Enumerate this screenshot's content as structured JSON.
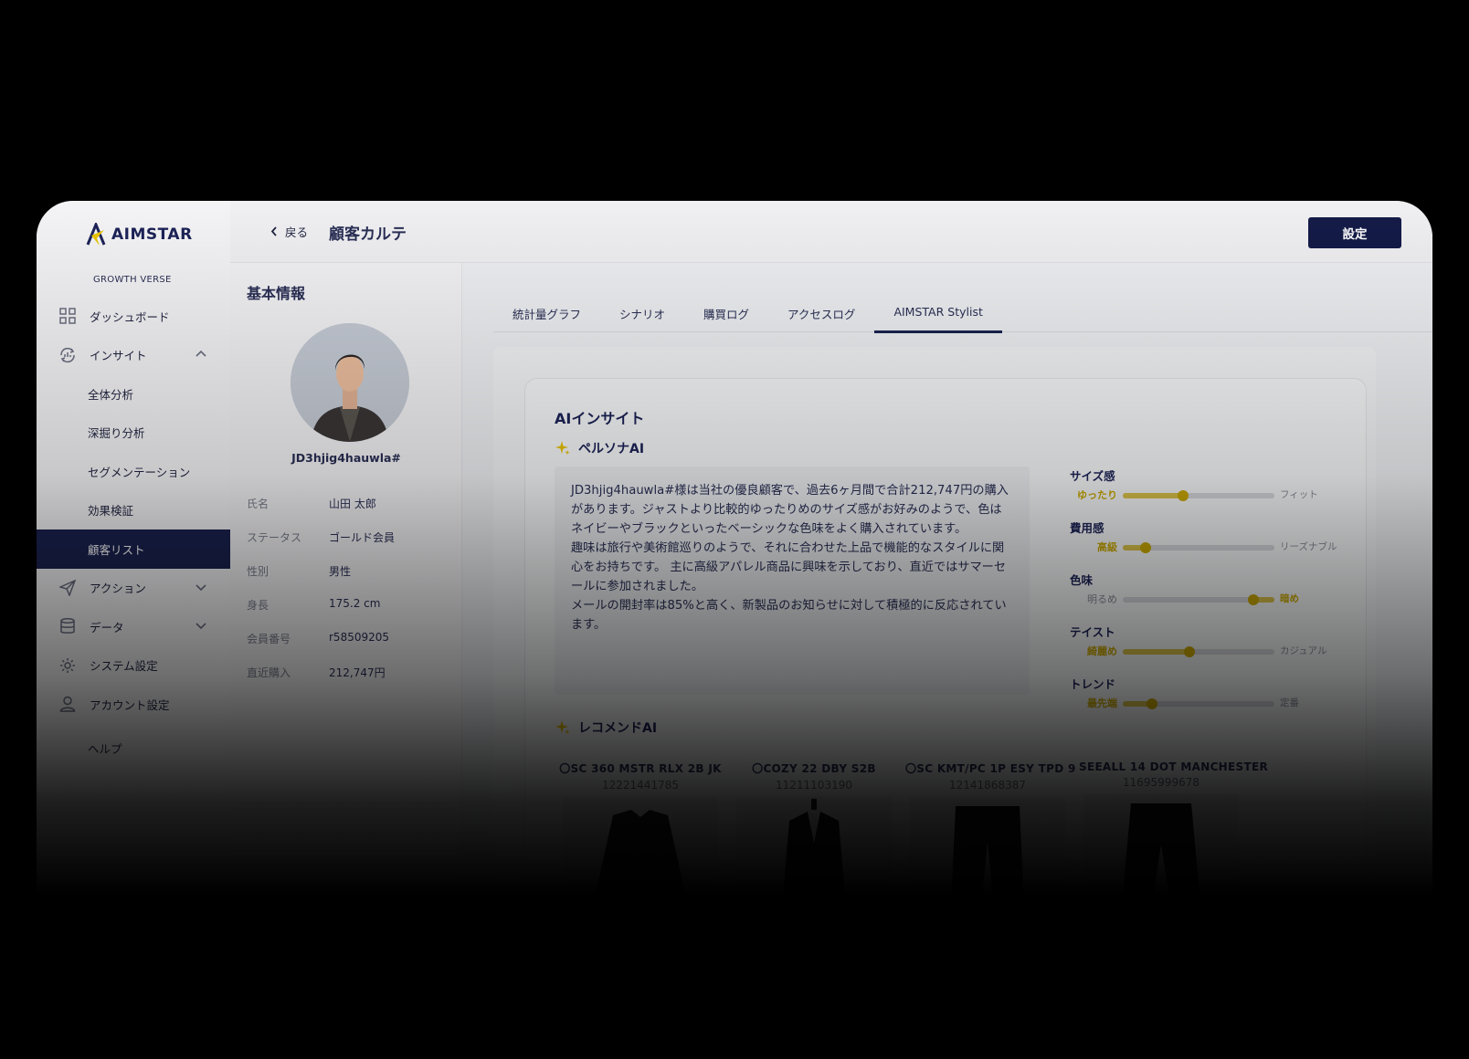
{
  "sidebar": {
    "logo_text": "AIMSTAR",
    "tagline": "GROWTH VERSE",
    "items": [
      {
        "label": "ダッシュボード"
      },
      {
        "label": "インサイト"
      },
      {
        "label": "全体分析"
      },
      {
        "label": "深掘り分析"
      },
      {
        "label": "セグメンテーション"
      },
      {
        "label": "効果検証"
      },
      {
        "label": "顧客リスト"
      },
      {
        "label": "アクション"
      },
      {
        "label": "データ"
      },
      {
        "label": "システム設定"
      },
      {
        "label": "アカウント設定"
      },
      {
        "label": "ヘルプ"
      }
    ]
  },
  "header": {
    "back_label": "戻る",
    "title": "顧客カルテ",
    "settings_label": "設定"
  },
  "info": {
    "title": "基本情報",
    "user_id": "JD3hjig4hauwla#",
    "fields": [
      {
        "key": "氏名",
        "value": "山田 太郎"
      },
      {
        "key": "ステータス",
        "value": "ゴールド会員"
      },
      {
        "key": "性別",
        "value": "男性"
      },
      {
        "key": "身長",
        "value": "175.2 cm"
      },
      {
        "key": "会員番号",
        "value": "r58509205"
      },
      {
        "key": "直近購入",
        "value": "212,747円"
      }
    ]
  },
  "tabs": [
    {
      "label": "統計量グラフ"
    },
    {
      "label": "シナリオ"
    },
    {
      "label": "購買ログ"
    },
    {
      "label": "アクセスログ"
    },
    {
      "label": "AIMSTAR Stylist"
    }
  ],
  "insight": {
    "title": "AIインサイト",
    "persona_title": "ペルソナAI",
    "persona_text": "JD3hjig4hauwla#様は当社の優良顧客で、過去6ヶ月間で合計212,747円の購入があります。ジャストより比較的ゆったりめのサイズ感がお好みのようで、色はネイビーやブラックといったベーシックな色味をよく購入されています。\n趣味は旅行や美術館巡りのようで、それに合わせた上品で機能的なスタイルに関心をお持ちです。 主に高級アパレル商品に興味を示しており、直近ではサマーセールに参加されました。\nメールの開封率は85%と高く、新製品のお知らせに対して積極的に反応されています。",
    "attributes": [
      {
        "name": "サイズ感",
        "left": "ゆったり",
        "right": "フィット",
        "value": 0.4,
        "highlight": "left"
      },
      {
        "name": "費用感",
        "left": "高級",
        "right": "リーズナブル",
        "value": 0.15,
        "highlight": "left"
      },
      {
        "name": "色味",
        "left": "明るめ",
        "right": "暗め",
        "value": 0.86,
        "highlight": "right"
      },
      {
        "name": "テイスト",
        "left": "綺麗め",
        "right": "カジュアル",
        "value": 0.44,
        "highlight": "left"
      },
      {
        "name": "トレンド",
        "left": "最先端",
        "right": "定番",
        "value": 0.19,
        "highlight": "left"
      }
    ],
    "recommend_title": "レコメンドAI",
    "products": [
      {
        "name": "〇SC 360 MSTR RLX 2B JK",
        "code": "12221441785"
      },
      {
        "name": "〇COZY 22 DBY S2B",
        "code": "11211103190"
      },
      {
        "name": "〇SC KMT/PC 1P ESY TPD 9",
        "code": "12141868387"
      },
      {
        "name": "SEEALL 14 DOT MANCHESTER",
        "code": "11695999678"
      }
    ]
  },
  "colors": {
    "navy": "#1a2250",
    "gold": "#c9a800"
  }
}
